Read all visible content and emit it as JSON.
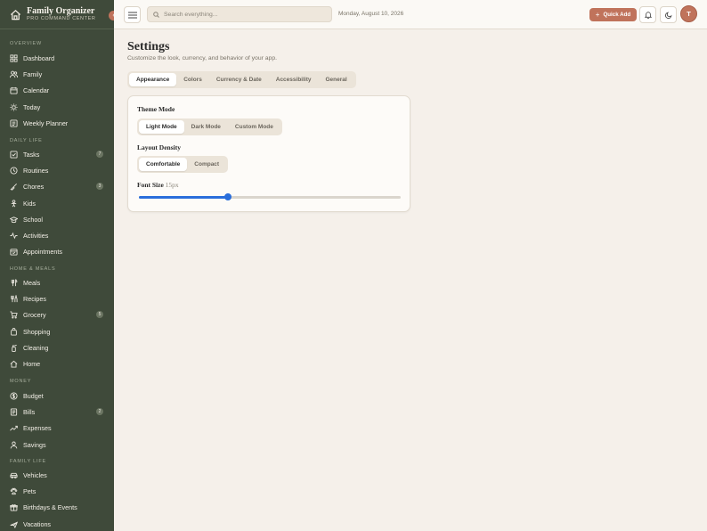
{
  "brand": {
    "title": "Family Organizer",
    "subtitle": "PRO COMMAND CENTER",
    "collapse_glyph": "‹"
  },
  "sidebar": {
    "sections": [
      {
        "label": "OVERVIEW",
        "items": [
          {
            "label": "Dashboard",
            "icon": "grid-icon"
          },
          {
            "label": "Family",
            "icon": "users-icon"
          },
          {
            "label": "Calendar",
            "icon": "calendar-icon"
          },
          {
            "label": "Today",
            "icon": "sun-icon"
          },
          {
            "label": "Weekly Planner",
            "icon": "planner-icon"
          }
        ]
      },
      {
        "label": "DAILY LIFE",
        "items": [
          {
            "label": "Tasks",
            "icon": "checkbox-icon",
            "badge": "7"
          },
          {
            "label": "Routines",
            "icon": "clock-icon"
          },
          {
            "label": "Chores",
            "icon": "broom-icon",
            "badge": "3"
          },
          {
            "label": "Kids",
            "icon": "kids-icon"
          },
          {
            "label": "School",
            "icon": "graduation-cap-icon"
          },
          {
            "label": "Activities",
            "icon": "activity-icon"
          },
          {
            "label": "Appointments",
            "icon": "appointment-icon"
          }
        ]
      },
      {
        "label": "HOME & MEALS",
        "items": [
          {
            "label": "Meals",
            "icon": "utensils-icon"
          },
          {
            "label": "Recipes",
            "icon": "recipe-icon"
          },
          {
            "label": "Grocery",
            "icon": "cart-icon",
            "badge": "5"
          },
          {
            "label": "Shopping",
            "icon": "shopping-bag-icon"
          },
          {
            "label": "Cleaning",
            "icon": "spray-bottle-icon"
          },
          {
            "label": "Home",
            "icon": "home-icon"
          }
        ]
      },
      {
        "label": "MONEY",
        "items": [
          {
            "label": "Budget",
            "icon": "dollar-icon"
          },
          {
            "label": "Bills",
            "icon": "receipt-icon",
            "badge": "2"
          },
          {
            "label": "Expenses",
            "icon": "trend-icon"
          },
          {
            "label": "Savings",
            "icon": "piggy-bank-icon"
          }
        ]
      },
      {
        "label": "FAMILY LIFE",
        "items": [
          {
            "label": "Vehicles",
            "icon": "car-icon"
          },
          {
            "label": "Pets",
            "icon": "paw-icon"
          },
          {
            "label": "Birthdays & Events",
            "icon": "gift-icon"
          },
          {
            "label": "Vacations",
            "icon": "plane-icon"
          }
        ]
      }
    ]
  },
  "topbar": {
    "search_placeholder": "Search everything...",
    "date": "Monday, August 10, 2026",
    "quick_add_label": "Quick Add",
    "avatar_initial": "T"
  },
  "page": {
    "title": "Settings",
    "subtitle": "Customize the look, currency, and behavior of your app.",
    "tabs": [
      "Appearance",
      "Colors",
      "Currency & Date",
      "Accessibility",
      "General"
    ],
    "active_tab": 0
  },
  "appearance": {
    "theme_mode_label": "Theme Mode",
    "theme_options": [
      "Light Mode",
      "Dark Mode",
      "Custom Mode"
    ],
    "theme_selected": 0,
    "density_label": "Layout Density",
    "density_options": [
      "Comfortable",
      "Compact"
    ],
    "density_selected": 0,
    "font_size_label": "Font Size",
    "font_size_value": "15px",
    "font_size_fraction": 0.34
  },
  "colors": {
    "accent": "#c0735b",
    "sidebar": "#3f4a3a",
    "slider": "#2a6edb",
    "background": "#f5f0ea"
  }
}
